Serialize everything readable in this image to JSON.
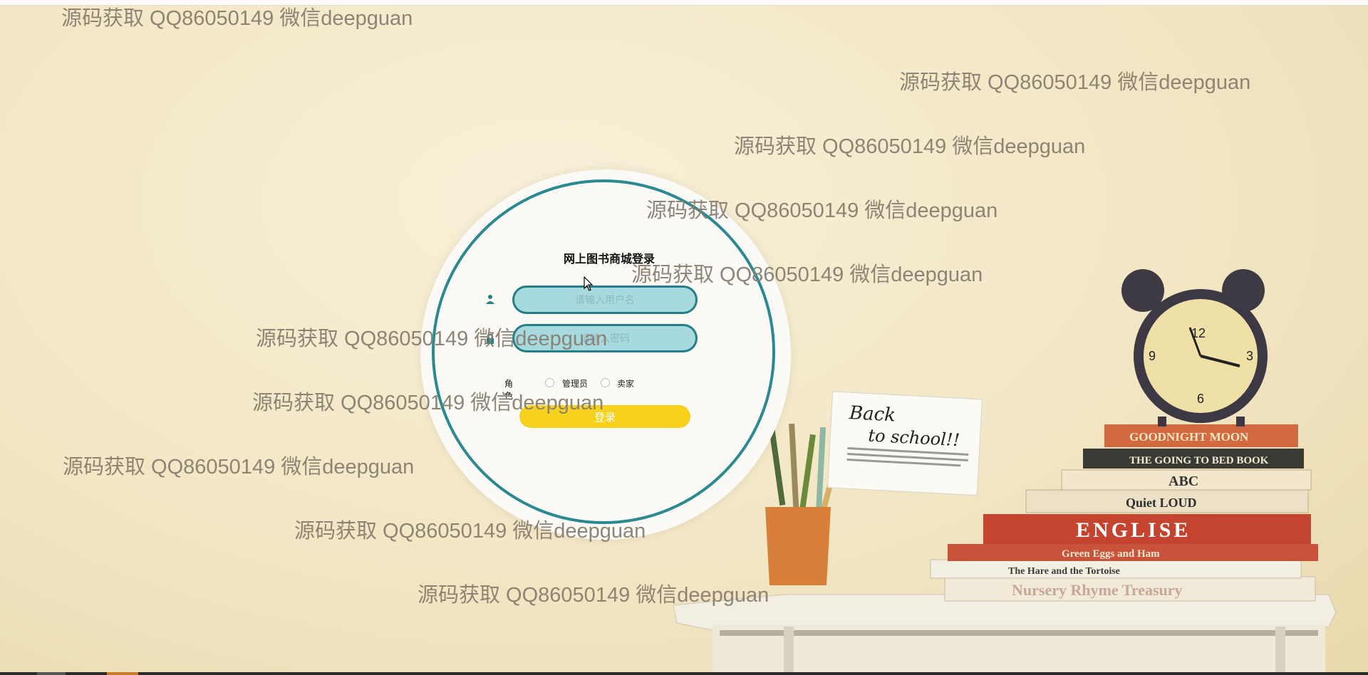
{
  "login": {
    "title": "网上图书商城登录",
    "username_placeholder": "请输入用户名",
    "password_placeholder": "请输入密码",
    "role_label": "角色",
    "roles": [
      "管理员",
      "卖家"
    ],
    "submit_label": "登录"
  },
  "watermark_text": "源码获取 QQ86050149 微信deepguan",
  "decor": {
    "note_line1": "Back",
    "note_line2": "to school!!",
    "book_titles": [
      "GOODNIGHT MOON",
      "THE GOING TO BED BOOK",
      "ABC",
      "Quiet LOUD",
      "ENGLISE",
      "Green Eggs and Ham",
      "The Hare and the Tortoise",
      "Nursery Rhyme Treasury"
    ]
  },
  "colors": {
    "accent": "#2b8a91",
    "field_fill": "#a6dadf",
    "button": "#f7d21c",
    "background": "#f2e6c4"
  }
}
